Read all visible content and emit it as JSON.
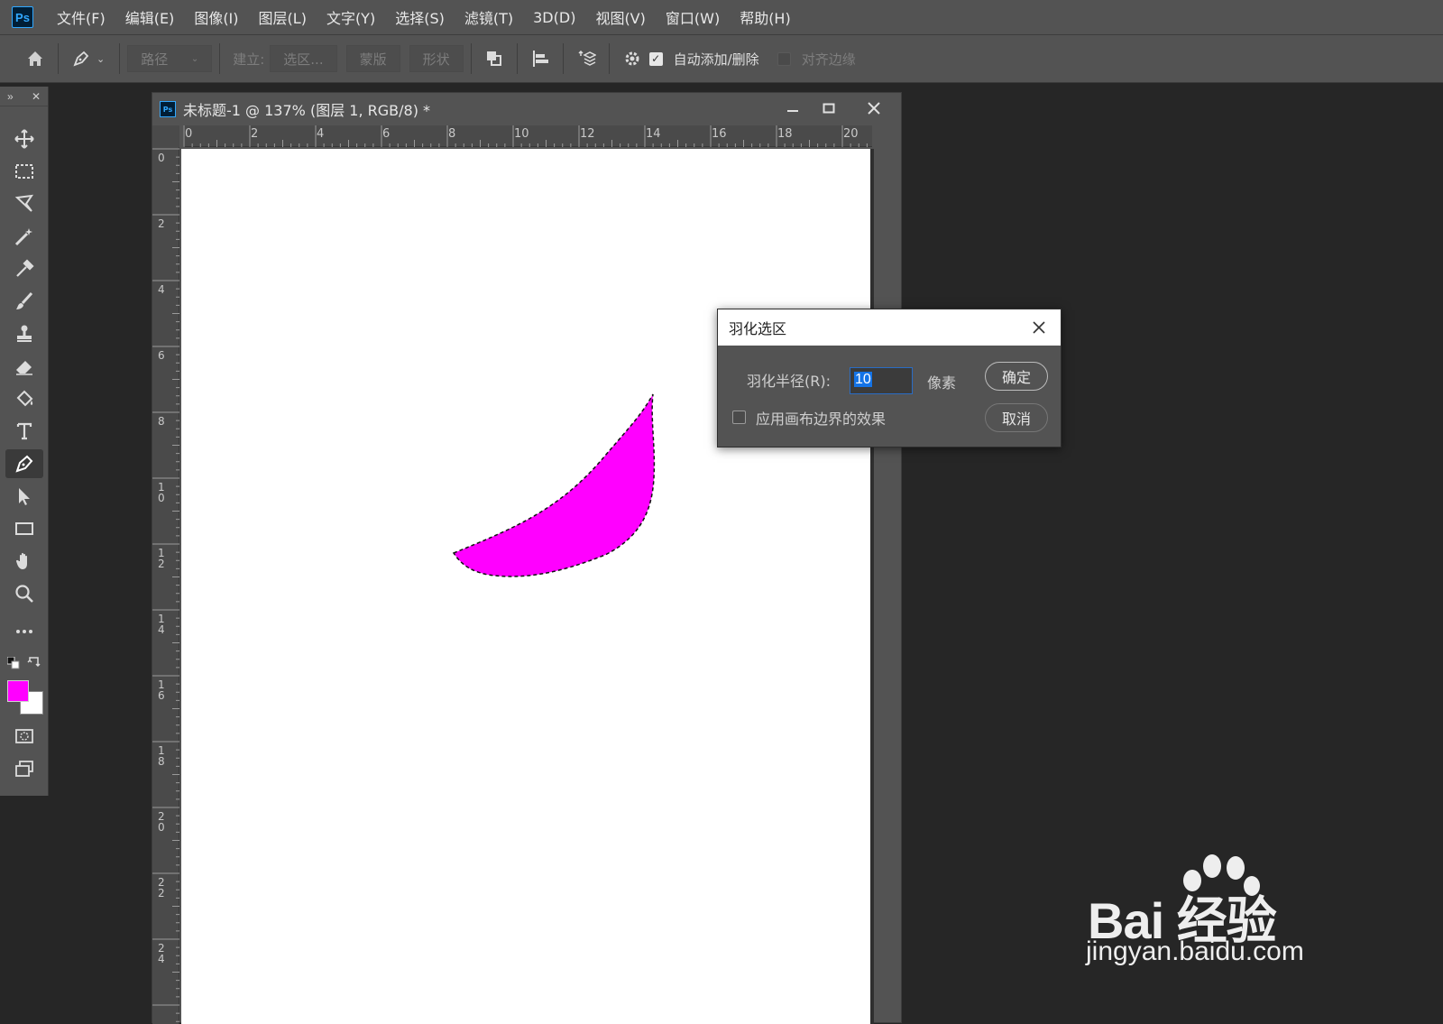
{
  "app": {
    "logo": "Ps",
    "menu": [
      "文件(F)",
      "编辑(E)",
      "图像(I)",
      "图层(L)",
      "文字(Y)",
      "选择(S)",
      "滤镜(T)",
      "3D(D)",
      "视图(V)",
      "窗口(W)",
      "帮助(H)"
    ]
  },
  "options_bar": {
    "mode_select": "路径",
    "make_label": "建立:",
    "selection_button": "选区...",
    "mask_button": "蒙版",
    "shape_button": "形状",
    "auto_add_delete": {
      "label": "自动添加/删除",
      "checked": true
    },
    "align_edges": {
      "label": "对齐边缘",
      "checked": false
    }
  },
  "toolbar": {
    "tools": [
      "move-tool",
      "marquee-tool",
      "lasso-tool",
      "magic-wand-tool",
      "eyedropper-tool",
      "brush-tool",
      "clone-stamp-tool",
      "eraser-tool",
      "paint-bucket-tool",
      "type-tool",
      "pen-tool",
      "path-selection-tool",
      "rectangle-tool",
      "hand-tool",
      "zoom-tool",
      "more-tools"
    ],
    "active_tool": "pen-tool",
    "foreground_color": "#ff00ff",
    "background_color": "#ffffff"
  },
  "document": {
    "title": "未标题-1 @ 137% (图层 1, RGB/8) *",
    "ruler_top": [
      "0",
      "2",
      "4",
      "6",
      "8",
      "10",
      "12",
      "14",
      "16",
      "18",
      "20"
    ],
    "ruler_left": [
      "0",
      "2",
      "4",
      "6",
      "8",
      "1\n0",
      "1\n2",
      "1\n4",
      "1\n6",
      "1\n8",
      "2\n0",
      "2\n2",
      "2\n4"
    ],
    "shape_color": "#ff00ff"
  },
  "dialog": {
    "title": "羽化选区",
    "radius_label": "羽化半径(R):",
    "radius_value": "10",
    "unit": "像素",
    "ok_button": "确定",
    "cancel_button": "取消",
    "apply_canvas_edge": {
      "label": "应用画布边界的效果",
      "checked": false
    }
  },
  "watermark": {
    "brand": "Bai  经验",
    "url": "jingyan.baidu.com"
  }
}
